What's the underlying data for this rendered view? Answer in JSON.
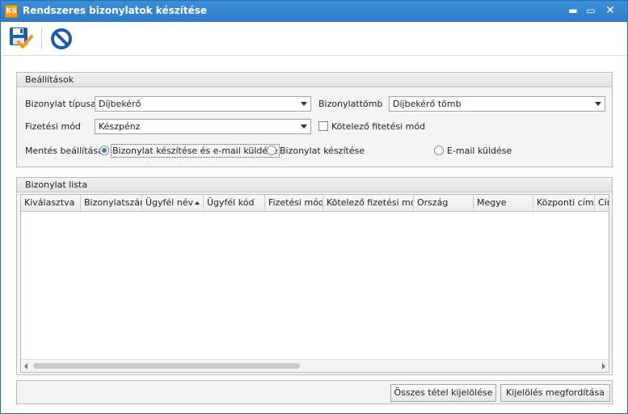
{
  "window": {
    "icon_text": "KS",
    "title": "Rendszeres bizonylatok készítése",
    "minimize_glyph": "▬",
    "maximize_glyph": "▭",
    "close_glyph": "✕"
  },
  "toolbar": {
    "items": [
      {
        "icon": "save-check-icon"
      },
      {
        "icon": "cancel-icon"
      }
    ]
  },
  "settings": {
    "title": "Beállítások",
    "document_type_label": "Bizonylat típusa",
    "document_type_value": "Díjbekérő",
    "document_block_label": "Bizonylattömb",
    "document_block_value": "Díjbekérő tömb",
    "payment_method_label": "Fizetési mód",
    "payment_method_value": "Készpénz",
    "mandatory_payment_label": "Kötelező fitetési mód",
    "mandatory_payment_checked": false,
    "save_setting_label": "Mentés beállítása",
    "save_options": [
      {
        "label": "Bizonylat készítése és e-mail küldése",
        "selected": true
      },
      {
        "label": "Bizonylat készítése",
        "selected": false
      },
      {
        "label": "E-mail küldése",
        "selected": false
      }
    ]
  },
  "list": {
    "title": "Bizonylat lista",
    "columns": [
      "Kiválasztva",
      "Bizonylatszám",
      "Ügyfél név",
      "Ügyfél kód",
      "Fizetési mód",
      "Kötelező fizetési mód",
      "Ország",
      "Megye",
      "Központi cím",
      "Cím"
    ],
    "sorted_column": "Ügyfél név",
    "sort_direction": "ascending",
    "rows": []
  },
  "buttons": {
    "select_all": "Összes tétel kijelölése",
    "invert_selection": "Kijelölés megfordítása"
  },
  "colors": {
    "titlebar": "#2e7ccb",
    "accent": "#3b7fd1",
    "save_icon": "#1f5fa8",
    "check_icon": "#f29a17",
    "cancel_icon": "#1c5cb0"
  }
}
